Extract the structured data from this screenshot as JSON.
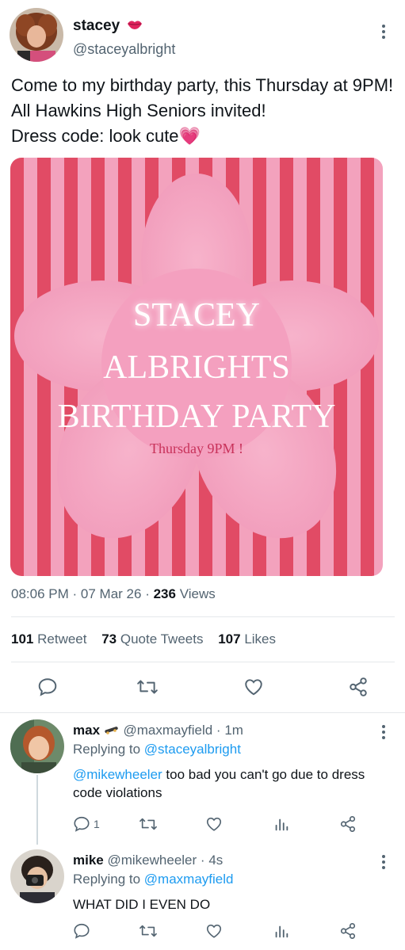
{
  "tweet": {
    "display_name": "stacey",
    "name_emoji": "lips",
    "handle": "@staceyalbright",
    "text_line1": "Come to my birthday party, this Thursday at 9PM! All Hawkins High Seniors invited!",
    "text_line2": "Dress code: look cute",
    "text_emoji": "💗",
    "time": "08:06 PM",
    "date": "07 Mar 26",
    "views_count": "236",
    "views_label": "Views",
    "retweets_count": "101",
    "retweets_label": "Retweet",
    "quotes_count": "73",
    "quotes_label": "Quote Tweets",
    "likes_count": "107",
    "likes_label": "Likes",
    "media": {
      "line1": "STACEY",
      "line2": "ALBRIGHTS",
      "line3": "BIRTHDAY PARTY",
      "subtitle": "Thursday 9PM !"
    }
  },
  "replies": [
    {
      "display_name": "max",
      "name_emoji": "skateboard",
      "handle": "@maxmayfield",
      "separator": "·",
      "time": "1m",
      "replying_prefix": "Replying to",
      "replying_to": "@staceyalbright",
      "mention": "@mikewheeler",
      "text": " too bad you can't go due to dress code violations",
      "reply_count": "1"
    },
    {
      "display_name": "mike",
      "handle": "@mikewheeler",
      "separator": "·",
      "time": "4s",
      "replying_prefix": "Replying to",
      "replying_to": "@maxmayfield",
      "text": "WHAT DID I EVEN DO"
    }
  ],
  "colors": {
    "accent": "#1d9bf0",
    "secondary_text": "#536471",
    "stripe_red": "#e14b65",
    "stripe_pink": "#f3a2bd",
    "flower_pink": "#f4a0bf",
    "subtitle_red": "#c8325a"
  },
  "icons": [
    "reply-icon",
    "retweet-icon",
    "like-icon",
    "share-icon",
    "analytics-icon",
    "more-icon"
  ]
}
